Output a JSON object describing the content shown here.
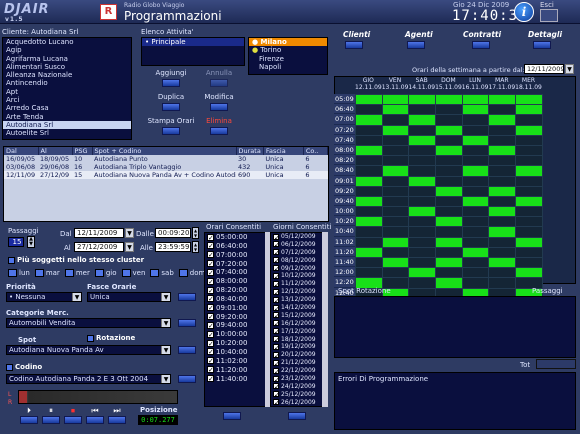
{
  "header": {
    "logo": "DJAIR",
    "logo_sub": "v1.5",
    "app_icon": "R",
    "station": "Radio Globo Viaggio",
    "title": "Programmazioni",
    "date": "Gio 24 Dic 2009",
    "clock": "17:40:37",
    "info": "i",
    "exit_label": "Esci"
  },
  "clients": {
    "label": "Cliente: Autodiana Srl",
    "items": [
      "Acquedotto Lucano",
      "Agip",
      "Agrifarma Lucana",
      "Alimentari Susco",
      "Alleanza Nazionale",
      "Antincendio",
      "Apt",
      "Arci",
      "Arredo Casa",
      "Arte Tenda",
      "Autodiana Srl",
      "Autoelite Srl"
    ],
    "selected_index": 10
  },
  "elenco": {
    "label": "Elenco Attivita'",
    "items": [
      "Principale"
    ]
  },
  "cities": {
    "items": [
      "Milano",
      "Torino",
      "Firenze",
      "Napoli"
    ],
    "selected_index": 0
  },
  "actions": {
    "aggiungi": "Aggiungi",
    "annulla": "Annulla",
    "duplica": "Duplica",
    "modifica": "Modifica",
    "stampa": "Stampa Orari",
    "elimina": "Elimina"
  },
  "spots_table": {
    "headers": [
      "Dal",
      "Al",
      "PSG",
      "Spot + Codino",
      "Durata",
      "Fascia",
      "Co.."
    ],
    "rows": [
      [
        "16/09/05",
        "18/09/05",
        "10",
        "Autodiana Punto",
        "30",
        "Unica",
        "6"
      ],
      [
        "03/06/08",
        "29/06/08",
        "16",
        "Autodiana Triplo Vantaggio",
        "432",
        "Unica",
        "6"
      ],
      [
        "12/11/09",
        "27/12/09",
        "15",
        "Autodiana Nuova Panda Av + Codino Autodiana...",
        "690",
        "Unica",
        "6"
      ]
    ]
  },
  "form": {
    "passaggi_label": "Passaggi",
    "passaggi_value": "15",
    "dal_label": "Dal",
    "dal_value": "12/11/2009",
    "al_label": "Al",
    "al_value": "27/12/2009",
    "dalle_label": "Dalle",
    "dalle_value": "00:09:20",
    "alle_label": "Alle",
    "alle_value": "23:59:59",
    "cluster_label": "Più soggetti nello stesso cluster",
    "days": [
      "lun",
      "mar",
      "mer",
      "gio",
      "ven",
      "sab",
      "dom"
    ],
    "priorita_label": "Priorità",
    "priorita_value": "Nessuna",
    "fasce_label": "Fasce Orarie",
    "fasce_value": "Unica",
    "categorie_label": "Categorie Merc.",
    "categorie_value": "Automobili Vendita",
    "spot_label": "Spot",
    "rotazione_label": "Rotazione",
    "spot_value": "Autodiana Nuova Panda Av",
    "codino_label": "Codino",
    "codino_value": "Codino Autodiana Panda 2 E 3 Ott 2004",
    "posizione_label": "Posizione",
    "posizione_value": "0:07.277",
    "transport": [
      "⏵",
      "⏸",
      "⏹",
      "⏮",
      "⏭"
    ]
  },
  "orari": {
    "label": "Orari Consentiti",
    "items": [
      "05:00:00",
      "06:40:00",
      "07:00:00",
      "07:20:00",
      "07:40:00",
      "08:00:00",
      "08:20:00",
      "08:40:00",
      "09:01:00",
      "09:20:00",
      "09:40:00",
      "10:00:00",
      "10:20:00",
      "10:40:00",
      "11:02:00",
      "11:20:00",
      "11:40:00"
    ]
  },
  "giorni": {
    "label": "Giorni Consentiti",
    "items": [
      "05/12/2009",
      "06/12/2009",
      "07/12/2009",
      "08/12/2009",
      "09/12/2009",
      "10/12/2009",
      "11/12/2009",
      "12/12/2009",
      "13/12/2009",
      "14/12/2009",
      "15/12/2009",
      "16/12/2009",
      "17/12/2009",
      "18/12/2009",
      "19/12/2009",
      "20/12/2009",
      "21/12/2009",
      "22/12/2009",
      "23/12/2009",
      "24/12/2009",
      "25/12/2009",
      "26/12/2009"
    ]
  },
  "top_nav": [
    "Clienti",
    "Agenti",
    "Contratti",
    "Dettagli"
  ],
  "schedule": {
    "label": "Orari della settimana a partire dal:",
    "start_value": "12/11/2009",
    "days": [
      {
        "name": "GIO",
        "date": "12.11.09"
      },
      {
        "name": "VEN",
        "date": "13.11.09"
      },
      {
        "name": "SAB",
        "date": "14.11.09"
      },
      {
        "name": "DOM",
        "date": "15.11.09"
      },
      {
        "name": "LUN",
        "date": "16.11.09"
      },
      {
        "name": "MAR",
        "date": "17.11.09"
      },
      {
        "name": "MER",
        "date": "18.11.09"
      }
    ],
    "times": [
      "05:09",
      "06:40",
      "07:00",
      "07:20",
      "07:40",
      "08:00",
      "08:20",
      "08:40",
      "09:01",
      "09:20",
      "09:40",
      "10:00",
      "10:20",
      "10:40",
      "11:02",
      "11:20",
      "11:40",
      "12:00",
      "12:20",
      "12:40"
    ],
    "active": [
      [
        1,
        1,
        1,
        1,
        1,
        1,
        1
      ],
      [
        0,
        1,
        0,
        0,
        1,
        0,
        1
      ],
      [
        1,
        0,
        1,
        0,
        0,
        1,
        0
      ],
      [
        0,
        1,
        0,
        1,
        0,
        0,
        1
      ],
      [
        0,
        0,
        1,
        0,
        1,
        0,
        0
      ],
      [
        1,
        0,
        0,
        1,
        0,
        1,
        0
      ],
      [
        0,
        0,
        0,
        0,
        0,
        0,
        0
      ],
      [
        0,
        1,
        0,
        0,
        1,
        0,
        1
      ],
      [
        1,
        0,
        1,
        0,
        0,
        0,
        0
      ],
      [
        0,
        0,
        0,
        1,
        0,
        1,
        0
      ],
      [
        1,
        0,
        0,
        0,
        1,
        0,
        1
      ],
      [
        0,
        0,
        1,
        0,
        0,
        1,
        0
      ],
      [
        1,
        0,
        0,
        1,
        0,
        0,
        0
      ],
      [
        0,
        0,
        0,
        0,
        0,
        1,
        0
      ],
      [
        0,
        1,
        0,
        1,
        0,
        0,
        1
      ],
      [
        1,
        0,
        0,
        0,
        1,
        0,
        0
      ],
      [
        0,
        1,
        0,
        1,
        0,
        1,
        0
      ],
      [
        0,
        0,
        1,
        0,
        0,
        0,
        1
      ],
      [
        1,
        0,
        0,
        1,
        0,
        0,
        0
      ],
      [
        0,
        1,
        0,
        0,
        1,
        0,
        1
      ]
    ]
  },
  "spot_rotazione": {
    "label": "Spot Rotazione",
    "passaggi": "Passaggi",
    "tot": "Tot"
  },
  "errori": {
    "label": "Errori Di Programmazione"
  }
}
